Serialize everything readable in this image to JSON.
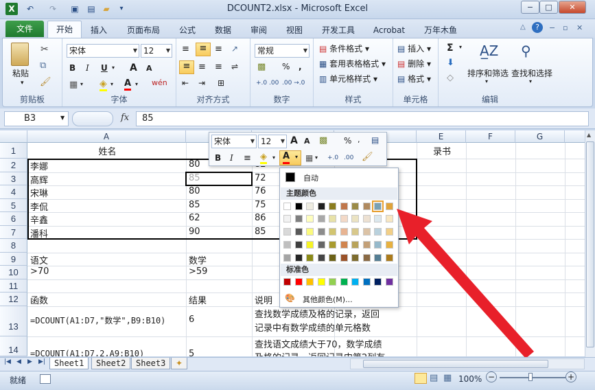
{
  "window": {
    "title": "DCOUNT2.xlsx - Microsoft Excel",
    "buttons": [
      "−",
      "□",
      "✕"
    ]
  },
  "quick_access": {
    "icons": [
      "excel-logo-icon",
      "undo-icon",
      "redo-icon",
      "save-icon",
      "print-preview-icon",
      "open-icon",
      "customize-icon"
    ]
  },
  "ribbon_tabs": {
    "file": "文件",
    "items": [
      "开始",
      "插入",
      "页面布局",
      "公式",
      "数据",
      "审阅",
      "视图",
      "开发工具",
      "Acrobat",
      "万年木鱼"
    ]
  },
  "ribbon": {
    "clipboard": {
      "label": "剪贴板",
      "paste": "粘贴"
    },
    "font": {
      "label": "字体",
      "name": "宋体",
      "size": "12",
      "bold": "B",
      "italic": "I",
      "underline": "U",
      "grow": "A",
      "shrink": "A",
      "phonetic": "wén"
    },
    "alignment": {
      "label": "对齐方式"
    },
    "number": {
      "label": "数字",
      "format": "常规",
      "percent": "%",
      "comma": ",",
      "inc": "+.0 .00",
      "dec": ".00 →.0"
    },
    "styles": {
      "label": "样式",
      "conditional": "条件格式",
      "table": "套用表格格式",
      "cell": "单元格样式"
    },
    "cells": {
      "label": "单元格",
      "insert": "插入",
      "delete": "删除",
      "format": "格式"
    },
    "editing": {
      "label": "编辑",
      "sigma": "Σ",
      "sort": "排序和筛选",
      "find": "查找和选择"
    }
  },
  "formula_bar": {
    "name_box": "B3",
    "fx": "fx",
    "value": "85"
  },
  "grid": {
    "columns": [
      "A",
      "B",
      "C",
      "D",
      "E",
      "F",
      "G"
    ],
    "rows": [
      "1",
      "2",
      "3",
      "4",
      "5",
      "6",
      "7",
      "8",
      "9",
      "10",
      "11",
      "12",
      "13",
      "14"
    ],
    "cells": {
      "A1": "姓名",
      "B1": "",
      "E1": "录书",
      "A2": "李娜",
      "B2": "80",
      "C2": "82",
      "A3": "高辉",
      "B3": "85",
      "C3": "72",
      "A4": "宋琳",
      "B4": "80",
      "C4": "76",
      "A5": "李侃",
      "B5": "85",
      "C5": "75",
      "A6": "辛鑫",
      "B6": "62",
      "C6": "86",
      "A7": "潘科",
      "B7": "90",
      "C7": "85",
      "A9": "语文",
      "B9": "数学",
      "A10": ">70",
      "B10": ">59",
      "A12": "函数",
      "B12": "结果",
      "C12": "说明",
      "A13": "=DCOUNT(A1:D7,\"数学\",B9:B10)",
      "B13": "6",
      "C13a": "查找数学成绩及格的记录，返回",
      "C13b": "记录中有数学成绩的单元格数",
      "A14": "=DCOUNT(A1:D7,2,A9:B10)",
      "B14": "5",
      "C14a": "查找语文成绩大于70，数学成绩",
      "C14b": "及格的记录，返回记录中第2列有"
    }
  },
  "mini_toolbar": {
    "font": "宋体",
    "size": "12",
    "bold": "B",
    "italic": "I",
    "percent": "%",
    "grow": "A",
    "shrink": "A",
    "font_color": "A",
    "inc": "+.0",
    "dec": ".00"
  },
  "color_panel": {
    "auto": "自动",
    "theme_title": "主题颜色",
    "standard_title": "标准色",
    "more": "其他颜色(M)...",
    "theme_colors": [
      "#ffffff",
      "#000000",
      "#eeece1",
      "#1f1f1f",
      "#8b7d1f",
      "#c0774b",
      "#9b8b47",
      "#b08a5f",
      "#7aa1b4",
      "#e0a33a"
    ],
    "theme_shades": [
      [
        "#f2f2f2",
        "#7f7f7f",
        "#fefebe",
        "#a8a8a8",
        "#e8e2a8",
        "#f3d9c7",
        "#ebe3c2",
        "#ede1d2",
        "#dce8ee",
        "#f8e7c2"
      ],
      [
        "#d9d9d9",
        "#595959",
        "#fbfa7d",
        "#8c8c8c",
        "#d2c571",
        "#e8b492",
        "#d8c88b",
        "#dcc3a6",
        "#b9d1dd",
        "#f2cf87"
      ],
      [
        "#bfbfbf",
        "#3f3f3f",
        "#f7f424",
        "#666666",
        "#a99b2f",
        "#d0844e",
        "#b8a35a",
        "#c3a078",
        "#96b9cb",
        "#e8b13f"
      ],
      [
        "#a5a5a5",
        "#262626",
        "#8b8a17",
        "#454545",
        "#6c6217",
        "#9a5228",
        "#7d6c2e",
        "#8a6a44",
        "#557e93",
        "#ac7b1b"
      ],
      [
        "#7f7f7f",
        "#0d0d0d",
        "#58570f",
        "#1e1e1e",
        "#453e0f",
        "#66361a",
        "#53481f",
        "#5c462d",
        "#385462",
        "#725212"
      ]
    ],
    "standard_colors": [
      "#c00000",
      "#ff0000",
      "#ffc000",
      "#ffff00",
      "#92d050",
      "#00b050",
      "#00b0f0",
      "#0070c0",
      "#002060",
      "#7030a0"
    ],
    "selected_index": 8
  },
  "sheets": {
    "tabs": [
      "Sheet1",
      "Sheet2",
      "Sheet3"
    ],
    "active": 0
  },
  "status": {
    "ready": "就绪",
    "zoom": "100%",
    "minus": "−",
    "plus": "+"
  },
  "annotation": {
    "arrow_color": "#e8202a"
  }
}
